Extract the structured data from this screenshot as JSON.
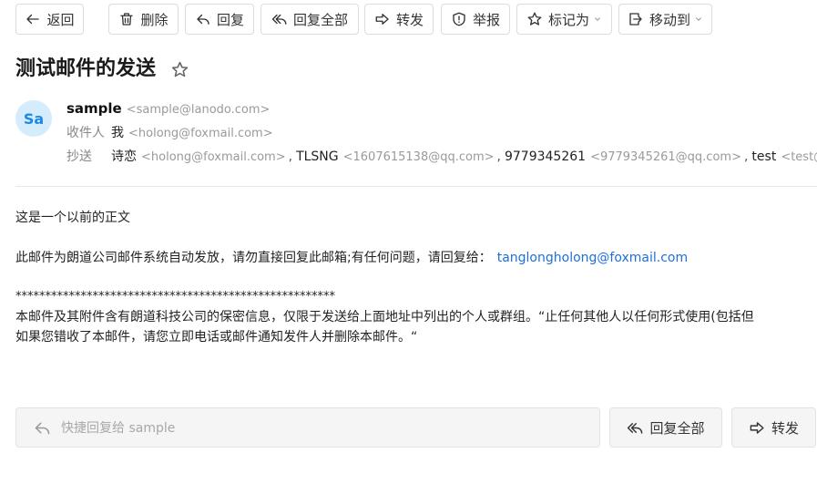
{
  "toolbar": {
    "back": "返回",
    "delete": "删除",
    "reply": "回复",
    "reply_all": "回复全部",
    "forward": "转发",
    "report": "举报",
    "mark_as": "标记为",
    "move_to": "移动到"
  },
  "email": {
    "subject": "测试邮件的发送",
    "sender": {
      "avatar": "Sa",
      "name": "sample",
      "address": "<sample@lanodo.com>"
    },
    "to": {
      "label": "收件人",
      "recipients": [
        {
          "name": "我",
          "address": "<holong@foxmail.com>"
        }
      ]
    },
    "cc": {
      "label": "抄送",
      "separator": ",",
      "recipients": [
        {
          "name": "诗恋",
          "address": "<holong@foxmail.com>"
        },
        {
          "name": "TLSNG",
          "address": "<1607615138@qq.com>"
        },
        {
          "name": "9779345261",
          "address": "<9779345261@qq.com>"
        },
        {
          "name": "test",
          "address": "<test@langdo"
        }
      ]
    },
    "body": {
      "line1": "这是一个以前的正文",
      "notice_prefix": "此邮件为朗道公司邮件系统自动发放，请勿直接回复此邮箱;有任何问题，请回复给：",
      "notice_link": "tanglongholong@foxmail.com",
      "stars": "******************************************************",
      "confidential_1": "本邮件及其附件含有朗道科技公司的保密信息，仅限于发送给上面地址中列出的个人或群组。“止任何其他人以任何形式使用(包括但",
      "confidential_2": "如果您错收了本邮件，请您立即电话或邮件通知发件人并删除本邮件。“"
    }
  },
  "quick_reply": {
    "placeholder": "快捷回复给 sample",
    "reply_all": "回复全部",
    "forward": "转发"
  },
  "icons": {
    "back": "arrow-left-icon",
    "delete": "trash-icon",
    "reply": "reply-icon",
    "reply_all": "reply-all-icon",
    "forward": "forward-icon",
    "report": "shield-alert-icon",
    "mark_as": "star-icon",
    "move_to": "move-to-folder-icon",
    "dropdown": "chevron-down-icon"
  },
  "colors": {
    "link": "#1e6fd9",
    "avatar_bg": "#d4ecfb",
    "avatar_text": "#1e88e5",
    "muted_text": "#9a9a9a"
  }
}
